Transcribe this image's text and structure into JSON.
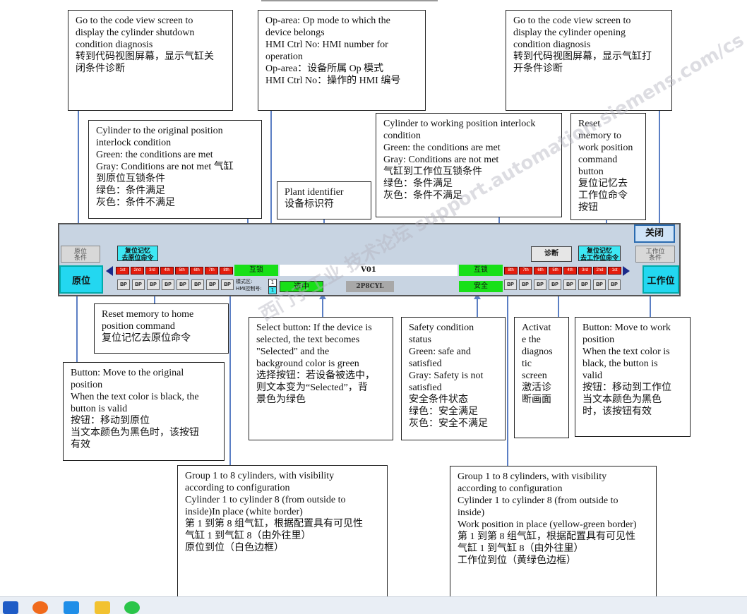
{
  "annotations": {
    "code_view_close": "Go to the code view screen to\ndisplay the cylinder shutdown\ncondition diagnosis\n转到代码视图屏幕，显示气缸关\n闭条件诊断",
    "op_area": "Op-area: Op mode to which the\ndevice belongs\nHMI Ctrl No: HMI number for\noperation\nOp-area：设备所属 Op 模式\nHMI Ctrl No：操作的 HMI 编号",
    "code_view_open": "Go to the code view screen to\ndisplay the cylinder opening\ncondition diagnosis\n转到代码视图屏幕，显示气缸打\n开条件诊断",
    "orig_interlock": "Cylinder to the original position\ninterlock condition\nGreen: the conditions are met\nGray: Conditions are not met 气缸\n到原位互锁条件\n绿色：条件满足\n灰色：条件不满足",
    "work_interlock": "Cylinder to working position interlock\ncondition\nGreen: the conditions are met\nGray: Conditions are not met\n气缸到工作位互锁条件\n绿色：条件满足\n灰色：条件不满足",
    "reset_work": "Reset\nmemory to\nwork position\ncommand\nbutton\n复位记忆去\n工作位命令\n按钮",
    "plant_id": "Plant identifier\n设备标识符",
    "reset_home": "Reset memory to home\nposition command\n复位记忆去原位命令",
    "select_btn": "Select button: If the device is\nselected, the text becomes\n\"Selected\" and the\nbackground color is green\n选择按钮：若设备被选中，\n则文本变为“Selected”，背\n景色为绿色",
    "safety": "Safety condition\nstatus\nGreen: safe and\nsatisfied\nGray: Safety is not\nsatisfied\n安全条件状态\n绿色：安全满足\n灰色：安全不满足",
    "activate_diag": "Activat\ne the\ndiagnos\ntic\nscreen\n激活诊\n断画面",
    "move_work": "Button: Move to work\nposition\nWhen the text color is\nblack, the button is\nvalid\n按钮：移动到工作位\n当文本颜色为黑色\n时，该按钮有效",
    "move_orig": "Button: Move to the original\nposition\nWhen the text color is black, the\nbutton is valid\n按钮：移动到原位\n当文本颜色为黑色时，该按钮\n有效",
    "group_left": "Group 1 to 8 cylinders, with visibility\naccording to configuration\nCylinder 1 to cylinder 8 (from outside to\ninside)In place (white border)\n第 1 到第 8 组气缸，根据配置具有可见性\n气缸 1 到气缸 8（由外往里）\n原位到位（白色边框）",
    "group_right": "Group 1 to 8 cylinders, with visibility\naccording to configuration\nCylinder 1 to cylinder 8 (from outside to\ninside)\nWork position in place (yellow-green border)\n第 1 到第 8 组气缸，根据配置具有可见性\n气缸 1 到气缸 8（由外往里）\n工作位到位（黄绿色边框）"
  },
  "panel": {
    "close_btn": "关闭",
    "orig_cond": "原位\n条件",
    "work_cond": "工作位\n条件",
    "reset_home_btn": "复位记忆\n去原位命令",
    "reset_work_btn": "复位记忆\n去工作位命令",
    "diag_btn": "诊断",
    "orig_btn": "原位",
    "work_btn": "工作位",
    "interlock_left": "互锁",
    "interlock_right": "互锁",
    "safety": "安全",
    "device_id": "V01",
    "mode_label": "模式区:",
    "hmi_label": "HMI控制号:",
    "mode_val": "1",
    "hmi_val": "1",
    "select": "选中",
    "tag": "2P8CYL",
    "bp": "BP"
  },
  "watermark": "西门子工业 技术论坛 support.automation.siemens.com/cs",
  "colors": {
    "cylinder_red": "#e41d0d",
    "green": "#18e018",
    "cyan": "#23d7f0",
    "arrow": "#5b7fc4"
  }
}
